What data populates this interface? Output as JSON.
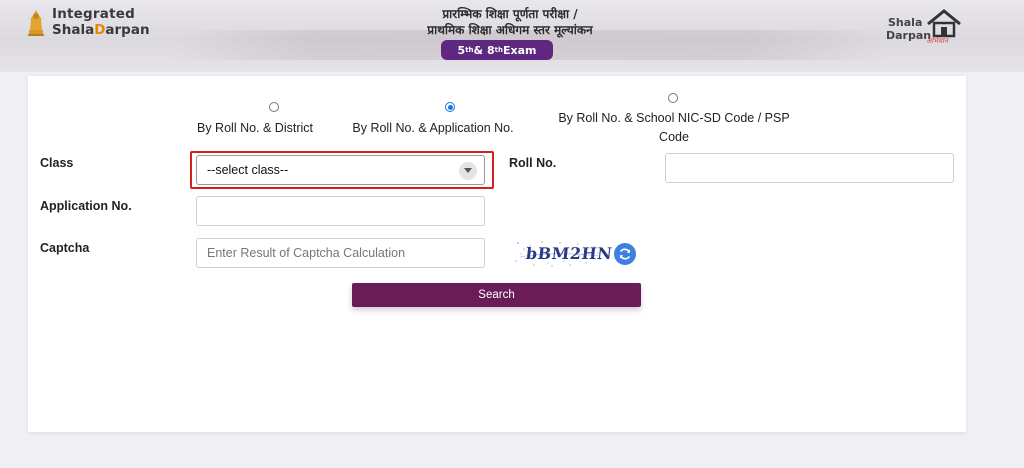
{
  "header": {
    "brand_line1": "Integrated",
    "brand_line2_prefix": "Shala",
    "brand_line2_accent": "D",
    "brand_line2_suffix": "arpan",
    "hindi_title_1": "प्रारम्भिक शिक्षा पूर्णता परीक्षा /",
    "hindi_title_2": "प्राथमिक शिक्षा अधिगम स्तर मूल्यांकन",
    "exam_badge": "5th & 8th Exam",
    "right_logo_line1": "Shala",
    "right_logo_line2": "Darpan",
    "right_logo_tag": "अभियान"
  },
  "search_mode": {
    "options": [
      {
        "label": "By Roll No. & District",
        "selected": false
      },
      {
        "label": "By Roll No. & Application No.",
        "selected": true
      },
      {
        "label_line1": "By Roll No. & School NIC-SD Code / PSP",
        "label_line2": "Code",
        "selected": false
      }
    ]
  },
  "form": {
    "class_label": "Class",
    "class_select_value": "--select class--",
    "roll_label": "Roll No.",
    "roll_value": "",
    "application_label": "Application No.",
    "application_value": "",
    "captcha_label": "Captcha",
    "captcha_placeholder": "Enter Result of Captcha Calculation",
    "captcha_text": "bBM2HN",
    "search_label": "Search"
  },
  "colors": {
    "accent_purple": "#5e2880",
    "button_maroon": "#6a1c57",
    "highlight_red": "#d62020",
    "radio_blue": "#1a73e8",
    "refresh_blue": "#3f7fe0"
  },
  "icons": {
    "emblem": "state-emblem-icon",
    "select_arrow": "chevron-down-icon",
    "refresh": "refresh-icon"
  }
}
